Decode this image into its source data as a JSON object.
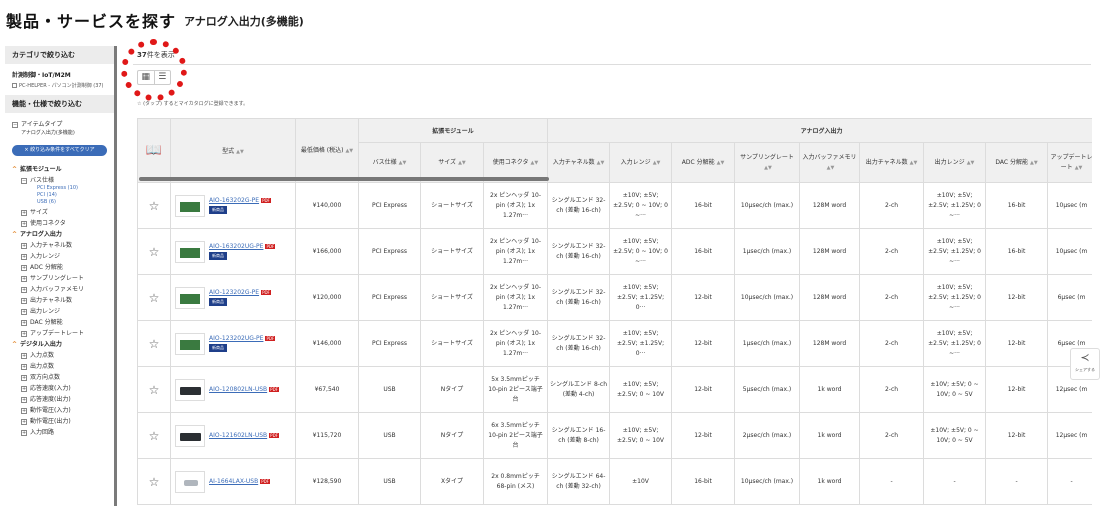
{
  "header": {
    "title": "製品・サービスを探す",
    "subtitle": "アナログ入出力(多機能)"
  },
  "sidebar": {
    "category_heading": "カテゴリで絞り込む",
    "category_title": "計測制御・IoT/M2M",
    "category_link": "PC-HELPER - パソコン計測制御 (37)",
    "spec_heading": "機能・仕様で絞り込む",
    "item_type_label": "アイテムタイプ",
    "item_type_value": "アナログ入出力(多機能)",
    "clear_button": "× 絞り込み条件をすべてクリア",
    "groups": [
      {
        "label": "拡張モジュール",
        "filters": [
          {
            "label": "バス仕様",
            "open": true,
            "options": [
              "PCI Express (10)",
              "PCI (14)",
              "USB (6)"
            ]
          },
          {
            "label": "サイズ"
          },
          {
            "label": "使用コネクタ"
          }
        ]
      },
      {
        "label": "アナログ入出力",
        "filters": [
          {
            "label": "入力チャネル数"
          },
          {
            "label": "入力レンジ"
          },
          {
            "label": "ADC 分解能"
          },
          {
            "label": "サンプリングレート"
          },
          {
            "label": "入力バッファメモリ"
          },
          {
            "label": "出力チャネル数"
          },
          {
            "label": "出力レンジ"
          },
          {
            "label": "DAC 分解能"
          },
          {
            "label": "アップデートレート"
          }
        ]
      },
      {
        "label": "デジタル入出力",
        "filters": [
          {
            "label": "入力点数"
          },
          {
            "label": "出力点数"
          },
          {
            "label": "双方向点数"
          },
          {
            "label": "応答速度(入力)"
          },
          {
            "label": "応答速度(出力)"
          },
          {
            "label": "動作電圧(入力)"
          },
          {
            "label": "動作電圧(出力)"
          },
          {
            "label": "入力回路"
          }
        ]
      }
    ]
  },
  "results": {
    "count_number": "37",
    "count_suffix": "件を表示",
    "hint": "☆ (タップ) するとマイカタログに登録できます。"
  },
  "table": {
    "group_headers": {
      "bus_module": "拡張モジュール",
      "analog_io": "アナログ入出力"
    },
    "columns": {
      "model": "型式",
      "min_price": "最低価格 (税込)",
      "bus": "バス仕様",
      "size": "サイズ",
      "connector": "使用コネクタ",
      "in_ch": "入力チャネル数",
      "in_range": "入力レンジ",
      "adc": "ADC 分解能",
      "sampling": "サンプリングレート",
      "in_buffer": "入力バッファメモリ",
      "out_ch": "出力チャネル数",
      "out_range": "出力レンジ",
      "dac": "DAC 分解能",
      "update": "アップデートレート"
    },
    "new_badge": "新商品",
    "pdf_label": "PDF",
    "rows": [
      {
        "thumb": "board",
        "model": "AIO-163202G-PE",
        "is_new": true,
        "price": "¥140,000",
        "bus": "PCI Express",
        "size": "ショートサイズ",
        "connector": "2x ピンヘッダ 10-pin (オス); 1x 1.27m···",
        "in_ch": "シングルエンド 32-ch (差動 16-ch)",
        "in_range": "±10V; ±5V; ±2.5V; 0 ~ 10V; 0 ~···",
        "adc": "16-bit",
        "sampling": "10μsec/ch (max.)",
        "in_buffer": "128M word",
        "out_ch": "2-ch",
        "out_range": "±10V; ±5V; ±2.5V; ±1.25V; 0 ~···",
        "dac": "16-bit",
        "update": "10μsec (m"
      },
      {
        "thumb": "board",
        "model": "AIO-163202UG-PE",
        "is_new": true,
        "price": "¥166,000",
        "bus": "PCI Express",
        "size": "ショートサイズ",
        "connector": "2x ピンヘッダ 10-pin (オス); 1x 1.27m···",
        "in_ch": "シングルエンド 32-ch (差動 16-ch)",
        "in_range": "±10V; ±5V; ±2.5V; 0 ~ 10V; 0 ~···",
        "adc": "16-bit",
        "sampling": "1μsec/ch (max.)",
        "in_buffer": "128M word",
        "out_ch": "2-ch",
        "out_range": "±10V; ±5V; ±2.5V; ±1.25V; 0 ~···",
        "dac": "16-bit",
        "update": "10μsec (m"
      },
      {
        "thumb": "board",
        "model": "AIO-123202G-PE",
        "is_new": true,
        "price": "¥120,000",
        "bus": "PCI Express",
        "size": "ショートサイズ",
        "connector": "2x ピンヘッダ 10-pin (オス); 1x 1.27m···",
        "in_ch": "シングルエンド 32-ch (差動 16-ch)",
        "in_range": "±10V; ±5V; ±2.5V; ±1.25V; 0···",
        "adc": "12-bit",
        "sampling": "10μsec/ch (max.)",
        "in_buffer": "128M word",
        "out_ch": "2-ch",
        "out_range": "±10V; ±5V; ±2.5V; ±1.25V; 0 ~···",
        "dac": "12-bit",
        "update": "6μsec (m"
      },
      {
        "thumb": "board",
        "model": "AIO-123202UG-PE",
        "is_new": true,
        "price": "¥146,000",
        "bus": "PCI Express",
        "size": "ショートサイズ",
        "connector": "2x ピンヘッダ 10-pin (オス); 1x 1.27m···",
        "in_ch": "シングルエンド 32-ch (差動 16-ch)",
        "in_range": "±10V; ±5V; ±2.5V; ±1.25V; 0···",
        "adc": "12-bit",
        "sampling": "1μsec/ch (max.)",
        "in_buffer": "128M word",
        "out_ch": "2-ch",
        "out_range": "±10V; ±5V; ±2.5V; ±1.25V; 0 ~···",
        "dac": "12-bit",
        "update": "6μsec (m"
      },
      {
        "thumb": "usb",
        "model": "AIO-120802LN-USB",
        "is_new": false,
        "price": "¥67,540",
        "bus": "USB",
        "size": "Nタイプ",
        "connector": "5x 3.5mmピッチ 10-pin 2ピース端子台",
        "in_ch": "シングルエンド 8-ch (差動 4-ch)",
        "in_range": "±10V; ±5V; ±2.5V; 0 ~ 10V",
        "adc": "12-bit",
        "sampling": "5μsec/ch (max.)",
        "in_buffer": "1k word",
        "out_ch": "2-ch",
        "out_range": "±10V; ±5V; 0 ~ 10V; 0 ~ 5V",
        "dac": "12-bit",
        "update": "12μsec (m"
      },
      {
        "thumb": "usb",
        "model": "AIO-121602LN-USB",
        "is_new": false,
        "price": "¥115,720",
        "bus": "USB",
        "size": "Nタイプ",
        "connector": "6x 3.5mmピッチ 10-pin 2ピース端子台",
        "in_ch": "シングルエンド 16-ch (差動 8-ch)",
        "in_range": "±10V; ±5V; ±2.5V; 0 ~ 10V",
        "adc": "12-bit",
        "sampling": "2μsec/ch (max.)",
        "in_buffer": "1k word",
        "out_ch": "2-ch",
        "out_range": "±10V; ±5V; 0 ~ 10V; 0 ~ 5V",
        "dac": "12-bit",
        "update": "12μsec (m"
      },
      {
        "thumb": "small",
        "model": "AI-1664LAX-USB",
        "is_new": false,
        "price": "¥128,590",
        "bus": "USB",
        "size": "Xタイプ",
        "connector": "2x 0.8mmピッチ 68-pin (メス)",
        "in_ch": "シングルエンド 64-ch (差動 32-ch)",
        "in_range": "±10V",
        "adc": "16-bit",
        "sampling": "10μsec/ch (max.)",
        "in_buffer": "1k word",
        "out_ch": "-",
        "out_range": "-",
        "dac": "-",
        "update": "-"
      }
    ]
  },
  "share": {
    "label": "シェアする"
  },
  "colors": {
    "accent": "#3b6cb8",
    "badge": "#1f3f8a",
    "highlight": "#e01818",
    "group": "#e08020"
  }
}
